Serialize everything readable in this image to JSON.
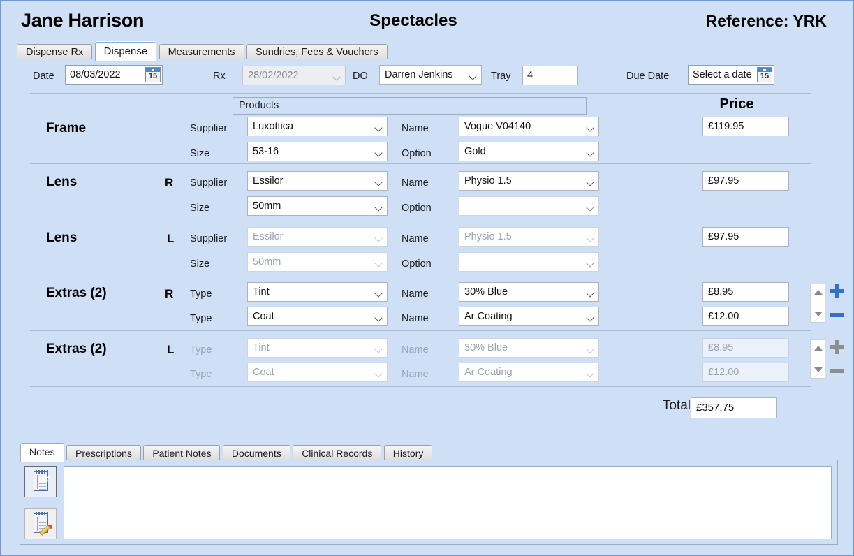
{
  "header": {
    "patient_name": "Jane Harrison",
    "title": "Spectacles",
    "reference": "Reference: YRK"
  },
  "top_tabs": [
    {
      "label": "Dispense Rx",
      "active": false
    },
    {
      "label": "Dispense",
      "active": true
    },
    {
      "label": "Measurements",
      "active": false
    },
    {
      "label": "Sundries, Fees & Vouchers",
      "active": false
    }
  ],
  "form": {
    "date_label": "Date",
    "date_value": "08/03/2022",
    "date_day_glyph": "15",
    "rx_label": "Rx",
    "rx_value": "28/02/2022",
    "do_label": "DO",
    "do_value": "Darren Jenkins",
    "tray_label": "Tray",
    "tray_value": "4",
    "due_date_label": "Due Date",
    "due_date_value": "Select a date",
    "due_date_day_glyph": "15"
  },
  "grid": {
    "products_header": "Products",
    "price_header": "Price",
    "supplier_label": "Supplier",
    "size_label": "Size",
    "type_label": "Type",
    "name_label": "Name",
    "option_label": "Option",
    "total_label": "Total",
    "total_value": "£357.75"
  },
  "rows": {
    "frame": {
      "title": "Frame",
      "eye": "",
      "supplier": "Luxottica",
      "size": "53-16",
      "name": "Vogue V04140",
      "option": "Gold",
      "price": "£119.95",
      "disabled": false
    },
    "lens_r": {
      "title": "Lens",
      "eye": "R",
      "supplier": "Essilor",
      "size": "50mm",
      "name": "Physio 1.5",
      "option": "",
      "price": "£97.95",
      "disabled": false
    },
    "lens_l": {
      "title": "Lens",
      "eye": "L",
      "supplier": "Essilor",
      "size": "50mm",
      "name": "Physio 1.5",
      "option": "",
      "price": "£97.95",
      "disabled": true
    },
    "extras_r": {
      "title": "Extras (2)",
      "eye": "R",
      "type1": "Tint",
      "type2": "Coat",
      "name1": "30% Blue",
      "name2": "Ar Coating",
      "price1": "£8.95",
      "price2": "£12.00",
      "disabled": false
    },
    "extras_l": {
      "title": "Extras (2)",
      "eye": "L",
      "type1": "Tint",
      "type2": "Coat",
      "name1": "30% Blue",
      "name2": "Ar Coating",
      "price1": "£8.95",
      "price2": "£12.00",
      "disabled": true
    }
  },
  "bottom_tabs": [
    {
      "label": "Notes",
      "active": true
    },
    {
      "label": "Prescriptions",
      "active": false
    },
    {
      "label": "Patient Notes",
      "active": false
    },
    {
      "label": "Documents",
      "active": false
    },
    {
      "label": "Clinical Records",
      "active": false
    },
    {
      "label": "History",
      "active": false
    }
  ],
  "notes": {
    "text": ""
  },
  "colors": {
    "background": "#cfdff5",
    "accent": "#2f72c6",
    "panel_border": "#8aa9cf",
    "disabled_text": "#9aa4b2"
  }
}
